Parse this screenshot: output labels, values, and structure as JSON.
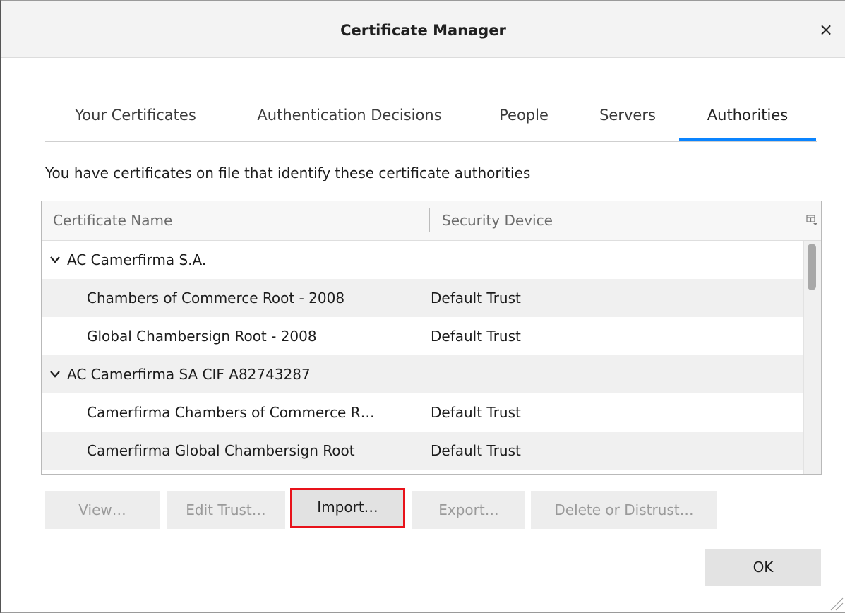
{
  "window": {
    "title": "Certificate Manager",
    "close_glyph": "×"
  },
  "tabs": [
    {
      "label": "Your Certificates",
      "active": false
    },
    {
      "label": "Authentication Decisions",
      "active": false
    },
    {
      "label": "People",
      "active": false
    },
    {
      "label": "Servers",
      "active": false
    },
    {
      "label": "Authorities",
      "active": true
    }
  ],
  "description": "You have certificates on file that identify these certificate authorities",
  "tree": {
    "columns": [
      "Certificate Name",
      "Security Device"
    ],
    "column_picker_icon": "column-picker-icon",
    "rows": [
      {
        "type": "group",
        "name": "AC Camerfirma S.A.",
        "expanded": true
      },
      {
        "type": "cert",
        "name": "Chambers of Commerce Root - 2008",
        "device": "Default Trust"
      },
      {
        "type": "cert",
        "name": "Global Chambersign Root - 2008",
        "device": "Default Trust"
      },
      {
        "type": "group",
        "name": "AC Camerfirma SA CIF A82743287",
        "expanded": true
      },
      {
        "type": "cert",
        "name": "Camerfirma Chambers of Commerce R…",
        "device": "Default Trust"
      },
      {
        "type": "cert",
        "name": "Camerfirma Global Chambersign Root",
        "device": "Default Trust"
      }
    ]
  },
  "buttons": {
    "view": {
      "label": "View…",
      "enabled": false
    },
    "edit_trust": {
      "label": "Edit Trust…",
      "enabled": false
    },
    "import": {
      "label": "Import…",
      "enabled": true,
      "highlighted": true
    },
    "export": {
      "label": "Export…",
      "enabled": false
    },
    "delete": {
      "label": "Delete or Distrust…",
      "enabled": false
    },
    "ok": {
      "label": "OK",
      "enabled": true
    }
  },
  "colors": {
    "accent": "#0a84ff",
    "highlight_border": "#e8121a"
  }
}
